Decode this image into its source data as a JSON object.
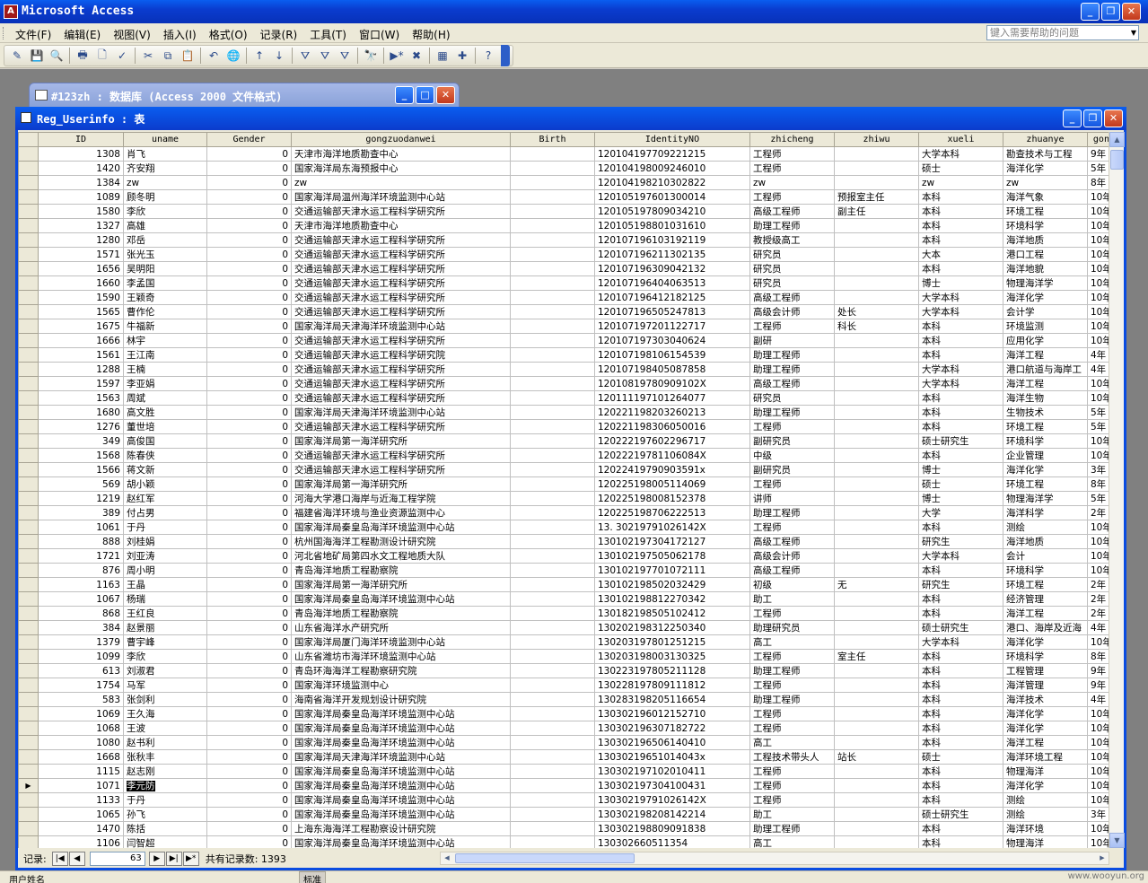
{
  "app": {
    "title": "Microsoft Access",
    "icon_text": "A"
  },
  "menu": {
    "items": [
      "文件(F)",
      "编辑(E)",
      "视图(V)",
      "插入(I)",
      "格式(O)",
      "记录(R)",
      "工具(T)",
      "窗口(W)",
      "帮助(H)"
    ],
    "help_placeholder": "键入需要帮助的问题"
  },
  "toolbar": {
    "icons": [
      "design-view-icon",
      "save-icon",
      "file-search-icon",
      "print-icon",
      "print-preview-icon",
      "spelling-icon",
      "cut-icon",
      "copy-icon",
      "paste-icon",
      "undo-icon",
      "hyperlink-icon",
      "sort-ascending-icon",
      "sort-descending-icon",
      "filter-by-selection-icon",
      "filter-by-form-icon",
      "apply-filter-icon",
      "find-icon",
      "new-record-icon",
      "delete-record-icon",
      "database-window-icon",
      "new-object-icon",
      "help-icon"
    ],
    "glyphs": [
      "✎",
      "💾",
      "🔍",
      "🖶",
      "🗋",
      "✓",
      "✂",
      "⧉",
      "📋",
      "↶",
      "🌐",
      "↑",
      "↓",
      "⛛",
      "⛛",
      "⛛",
      "🔭",
      "▶*",
      "✖",
      "▦",
      "✚",
      "?"
    ]
  },
  "db_window": {
    "title": "#123zh : 数据库 (Access 2000 文件格式)"
  },
  "table_window": {
    "title": "Reg_Userinfo : 表",
    "columns": [
      "ID",
      "uname",
      "Gender",
      "gongzuodanwei",
      "Birth",
      "IdentityNO",
      "zhicheng",
      "zhiwu",
      "xueli",
      "zhuanye",
      "gon"
    ],
    "rows": [
      [
        "1308",
        "肖飞",
        "0",
        "天津市海洋地质勘查中心",
        "",
        "120104197709221215",
        "工程师",
        "",
        "大学本科",
        "勘查技术与工程",
        "9年"
      ],
      [
        "1420",
        "齐安翔",
        "0",
        "国家海洋局东海预报中心",
        "",
        "120104198009246010",
        "工程师",
        "",
        "硕士",
        "海洋化学",
        "5年"
      ],
      [
        "1384",
        "zw",
        "0",
        "zw",
        "",
        "120104198210302822",
        "zw",
        "",
        "zw",
        "zw",
        "8年"
      ],
      [
        "1089",
        "顾冬明",
        "0",
        "国家海洋局温州海洋环境监测中心站",
        "",
        "120105197601300014",
        "工程师",
        "预报室主任",
        "本科",
        "海洋气象",
        "10年"
      ],
      [
        "1580",
        "李欣",
        "0",
        "交通运输部天津水运工程科学研究所",
        "",
        "120105197809034210",
        "高级工程师",
        "副主任",
        "本科",
        "环境工程",
        "10年"
      ],
      [
        "1327",
        "高雄",
        "0",
        "天津市海洋地质勘查中心",
        "",
        "120105198801031610",
        "助理工程师",
        "",
        "本科",
        "环境科学",
        "10年"
      ],
      [
        "1280",
        "邓岳",
        "0",
        "交通运输部天津水运工程科学研究所",
        "",
        "120107196103192119",
        "教授级高工",
        "",
        "本科",
        "海洋地质",
        "10年"
      ],
      [
        "1571",
        "张光玉",
        "0",
        "交通运输部天津水运工程科学研究所",
        "",
        "120107196211302135",
        "研究员",
        "",
        "大本",
        "港口工程",
        "10年"
      ],
      [
        "1656",
        "吴明阳",
        "0",
        "交通运输部天津水运工程科学研究所",
        "",
        "120107196309042132",
        "研究员",
        "",
        "本科",
        "海洋地貌",
        "10年"
      ],
      [
        "1660",
        "李孟国",
        "0",
        "交通运输部天津水运工程科学研究所",
        "",
        "120107196404063513",
        "研究员",
        "",
        "博士",
        "物理海洋学",
        "10年"
      ],
      [
        "1590",
        "王颖奇",
        "0",
        "交通运输部天津水运工程科学研究所",
        "",
        "120107196412182125",
        "高级工程师",
        "",
        "大学本科",
        "海洋化学",
        "10年"
      ],
      [
        "1565",
        "曹作伦",
        "0",
        "交通运输部天津水运工程科学研究所",
        "",
        "120107196505247813",
        "高级会计师",
        "处长",
        "大学本科",
        "会计学",
        "10年"
      ],
      [
        "1675",
        "牛福新",
        "0",
        "国家海洋局天津海洋环境监测中心站",
        "",
        "120107197201122717",
        "工程师",
        "科长",
        "本科",
        "环境监测",
        "10年"
      ],
      [
        "1666",
        "林宇",
        "0",
        "交通运输部天津水运工程科学研究所",
        "",
        "120107197303040624",
        "副研",
        "",
        "本科",
        "应用化学",
        "10年"
      ],
      [
        "1561",
        "王江南",
        "0",
        "交通运输部天津水运工程科学研究院",
        "",
        "120107198106154539",
        "助理工程师",
        "",
        "本科",
        "海洋工程",
        "4年"
      ],
      [
        "1288",
        "王楠",
        "0",
        "交通运输部天津水运工程科学研究所",
        "",
        "120107198405087858",
        "助理工程师",
        "",
        "大学本科",
        "港口航道与海岸工",
        "4年"
      ],
      [
        "1597",
        "李亚娟",
        "0",
        "交通运输部天津水运工程科学研究所",
        "",
        "12010819780909102X",
        "高级工程师",
        "",
        "大学本科",
        "海洋工程",
        "10年"
      ],
      [
        "1563",
        "周斌",
        "0",
        "交通运输部天津水运工程科学研究所",
        "",
        "120111197101264077",
        "研究员",
        "",
        "本科",
        "海洋生物",
        "10年"
      ],
      [
        "1680",
        "高文胜",
        "0",
        "国家海洋局天津海洋环境监测中心站",
        "",
        "120221198203260213",
        "助理工程师",
        "",
        "本科",
        "生物技术",
        "5年"
      ],
      [
        "1276",
        "董世培",
        "0",
        "交通运输部天津水运工程科学研究所",
        "",
        "120221198306050016",
        "工程师",
        "",
        "本科",
        "环境工程",
        "5年"
      ],
      [
        "349",
        "高俊国",
        "0",
        "国家海洋局第一海洋研究所",
        "",
        "120222197602296717",
        "副研究员",
        "",
        "硕士研究生",
        "环境科学",
        "10年"
      ],
      [
        "1568",
        "陈春侠",
        "0",
        "交通运输部天津水运工程科学研究所",
        "",
        "12022219781106084X",
        "中级",
        "",
        "本科",
        "企业管理",
        "10年"
      ],
      [
        "1566",
        "蒋文新",
        "0",
        "交通运输部天津水运工程科学研究所",
        "",
        "12022419790903591x",
        "副研究员",
        "",
        "博士",
        "海洋化学",
        "3年"
      ],
      [
        "569",
        "胡小颖",
        "0",
        "国家海洋局第一海洋研究所",
        "",
        "120225198005114069",
        "工程师",
        "",
        "硕士",
        "环境工程",
        "8年"
      ],
      [
        "1219",
        "赵红军",
        "0",
        "河海大学港口海岸与近海工程学院",
        "",
        "120225198008152378",
        "讲师",
        "",
        "博士",
        "物理海洋学",
        "5年"
      ],
      [
        "389",
        "付占男",
        "0",
        "福建省海洋环境与渔业资源监测中心",
        "",
        "120225198706222513",
        "助理工程师",
        "",
        "大学",
        "海洋科学",
        "2年"
      ],
      [
        "1061",
        "于丹",
        "0",
        "国家海洋局秦皇岛海洋环境监测中心站",
        "",
        "13. 30219791026142X",
        "工程师",
        "",
        "本科",
        "测绘",
        "10年"
      ],
      [
        "888",
        "刘桂娟",
        "0",
        "杭州国海海洋工程勘测设计研究院",
        "",
        "130102197304172127",
        "高级工程师",
        "",
        "研究生",
        "海洋地质",
        "10年"
      ],
      [
        "1721",
        "刘亚涛",
        "0",
        "河北省地矿局第四水文工程地质大队",
        "",
        "130102197505062178",
        "高级会计师",
        "",
        "大学本科",
        "会计",
        "10年"
      ],
      [
        "876",
        "周小明",
        "0",
        "青岛海洋地质工程勘察院",
        "",
        "130102197701072111",
        "高级工程师",
        "",
        "本科",
        "环境科学",
        "10年"
      ],
      [
        "1163",
        "王晶",
        "0",
        "国家海洋局第一海洋研究所",
        "",
        "130102198502032429",
        "初级",
        "无",
        "研究生",
        "环境工程",
        "2年"
      ],
      [
        "1067",
        "杨瑞",
        "0",
        "国家海洋局秦皇岛海洋环境监测中心站",
        "",
        "130102198812270342",
        "助工",
        "",
        "本科",
        "经济管理",
        "2年"
      ],
      [
        "868",
        "王红良",
        "0",
        "青岛海洋地质工程勘察院",
        "",
        "130182198505102412",
        "工程师",
        "",
        "本科",
        "海洋工程",
        "2年"
      ],
      [
        "384",
        "赵景丽",
        "0",
        "山东省海洋水产研究所",
        "",
        "130202198312250340",
        "助理研究员",
        "",
        "硕士研究生",
        "港口、海岸及近海",
        "4年"
      ],
      [
        "1379",
        "曹宇峰",
        "0",
        "国家海洋局厦门海洋环境监测中心站",
        "",
        "130203197801251215",
        "高工",
        "",
        "大学本科",
        "海洋化学",
        "10年"
      ],
      [
        "1099",
        "李欣",
        "0",
        "山东省潍坊市海洋环境监测中心站",
        "",
        "130203198003130325",
        "工程师",
        "室主任",
        "本科",
        "环境科学",
        "8年"
      ],
      [
        "613",
        "刘淑君",
        "0",
        "青岛环海海洋工程勘察研究院",
        "",
        "130223197805211128",
        "助理工程师",
        "",
        "本科",
        "工程管理",
        "9年"
      ],
      [
        "1754",
        "马军",
        "0",
        "国家海洋环境监测中心",
        "",
        "130228197809111812",
        "工程师",
        "",
        "本科",
        "海洋管理",
        "9年"
      ],
      [
        "583",
        "张剑利",
        "0",
        "海南省海洋开发规划设计研究院",
        "",
        "130283198205116654",
        "助理工程师",
        "",
        "本科",
        "海洋技术",
        "4年"
      ],
      [
        "1069",
        "王久海",
        "0",
        "国家海洋局秦皇岛海洋环境监测中心站",
        "",
        "130302196012152710",
        "工程师",
        "",
        "本科",
        "海洋化学",
        "10年"
      ],
      [
        "1068",
        "王波",
        "0",
        "国家海洋局秦皇岛海洋环境监测中心站",
        "",
        "130302196307182722",
        "工程师",
        "",
        "本科",
        "海洋化学",
        "10年"
      ],
      [
        "1080",
        "赵书利",
        "0",
        "国家海洋局秦皇岛海洋环境监测中心站",
        "",
        "130302196506140410",
        "高工",
        "",
        "本科",
        "海洋工程",
        "10年"
      ],
      [
        "1668",
        "张秋丰",
        "0",
        "国家海洋局天津海洋环境监测中心站",
        "",
        "13030219651014043x",
        "工程技术带头人",
        "站长",
        "硕士",
        "海洋环境工程",
        "10年"
      ],
      [
        "1115",
        "赵志刚",
        "0",
        "国家海洋局秦皇岛海洋环境监测中心站",
        "",
        "130302197102010411",
        "工程师",
        "",
        "本科",
        "物理海洋",
        "10年"
      ],
      [
        "1071",
        "李元防",
        "0",
        "国家海洋局秦皇岛海洋环境监测中心站",
        "",
        "130302197304100431",
        "工程师",
        "",
        "本科",
        "海洋化学",
        "10年"
      ],
      [
        "1133",
        "于丹",
        "0",
        "国家海洋局秦皇岛海洋环境监测中心站",
        "",
        "13030219791026142X",
        "工程师",
        "",
        "本科",
        "测绘",
        "10年"
      ],
      [
        "1065",
        "孙飞",
        "0",
        "国家海洋局秦皇岛海洋环境监测中心站",
        "",
        "130302198208142214",
        "助工",
        "",
        "硕士研究生",
        "测绘",
        "3年"
      ],
      [
        "1470",
        "陈括",
        "0",
        "上海东海海洋工程勘察设计研究院",
        "",
        "130302198809091838",
        "助理工程师",
        "",
        "本科",
        "海洋环境",
        "10年"
      ],
      [
        "1106",
        "闫智超",
        "0",
        "国家海洋局秦皇岛海洋环境监测中心站",
        "",
        "130302660511354",
        "高工",
        "",
        "本科",
        "物理海洋",
        "10年"
      ]
    ]
  },
  "nav": {
    "record_label": "记录:",
    "current": "63",
    "total_label": "共有记录数: 1393"
  },
  "status": {
    "text": "用户姓名",
    "mode": "标准",
    "watermark": "www.wooyun.org"
  }
}
